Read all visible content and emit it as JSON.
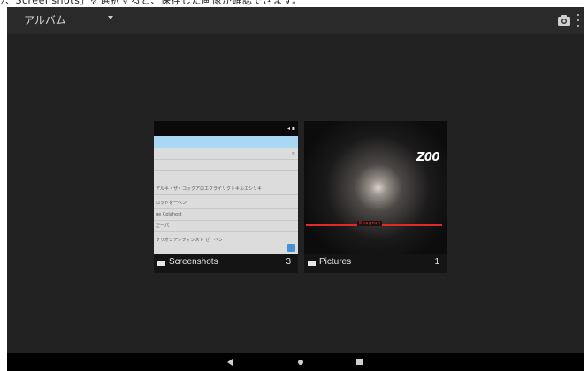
{
  "top_strip_text": "〉、Screenshots」を選択すると、保存した画像が確認できます。",
  "appbar": {
    "title": "アルバム",
    "icons": [
      "camera-icon",
      "overflow-menu-icon"
    ]
  },
  "albums": [
    {
      "name": "Screenshots",
      "count": "3",
      "thumbnail": {
        "rows": [
          "",
          "",
          "アルキ・ザ・コックアロエクライリクトキルエシリキ",
          "ロッドを一ベン",
          "ge Colahost",
          "だーパ",
          "クリオンアンフィンスト ゼーベン"
        ],
        "scroll_mark": "≡",
        "fab_color": "#4a90d9"
      }
    },
    {
      "name": "Pictures",
      "count": "1",
      "thumbnail": {
        "logo": "Z00",
        "red_text": "Shagrun",
        "line_color": "#e22828"
      }
    }
  ],
  "navbar": {
    "buttons": [
      "back-button",
      "home-button",
      "recents-button"
    ]
  },
  "colors": {
    "background": "#222222",
    "appbar": "#2a2a2a",
    "navbar": "#000000",
    "caption": "#141414"
  }
}
